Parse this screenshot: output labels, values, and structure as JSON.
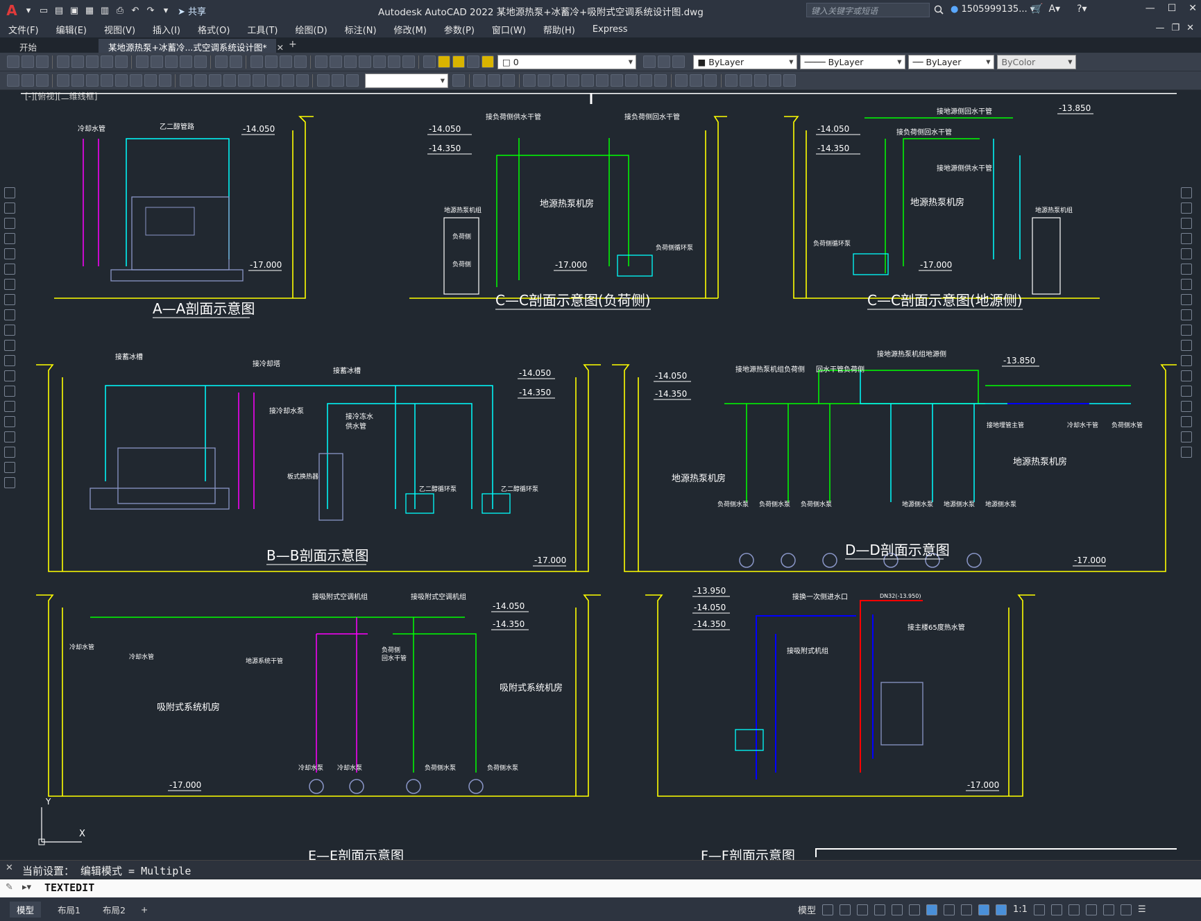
{
  "app": {
    "logo": "A",
    "title": "Autodesk AutoCAD 2022    某地源热泵+冰蓄冷+吸附式空调系统设计图.dwg",
    "share": "共享",
    "search_placeholder": "键入关键字或短语",
    "user": "1505999135...",
    "qa_icons": [
      "new-icon",
      "open-icon",
      "save-icon",
      "save-as-icon",
      "publish-icon",
      "print-icon",
      "undo-icon",
      "redo-icon"
    ]
  },
  "menu": [
    "文件(F)",
    "编辑(E)",
    "视图(V)",
    "插入(I)",
    "格式(O)",
    "工具(T)",
    "绘图(D)",
    "标注(N)",
    "修改(M)",
    "参数(P)",
    "窗口(W)",
    "帮助(H)",
    "Express"
  ],
  "tabs": {
    "start": "开始",
    "drawing": "某地源热泵+冰蓄冷...式空调系统设计图*"
  },
  "toolbar": {
    "layer_value": "0",
    "color": "ByLayer",
    "linetype": "ByLayer",
    "lineweight": "ByLayer",
    "plotstyle": "ByColor"
  },
  "viewport_label": "[-][俯视][二维线框]",
  "drawing": {
    "panels": [
      {
        "id": "aa",
        "title": "A—A剖面示意图",
        "room": "",
        "elevations": [
          "-14.050",
          "-17.000"
        ]
      },
      {
        "id": "cc1",
        "title": "C—C剖面示意图(负荷侧)",
        "room": "地源热泵机房",
        "elevations": [
          "-14.050",
          "-14.350",
          "-17.000"
        ]
      },
      {
        "id": "cc2",
        "title": "C—C剖面示意图(地源侧)",
        "room": "地源热泵机房",
        "elevations": [
          "-14.050",
          "-14.350",
          "-13.850",
          "-17.000"
        ]
      },
      {
        "id": "bb",
        "title": "B—B剖面示意图",
        "room": "",
        "elevations": [
          "-14.050",
          "-14.350",
          "-17.000"
        ]
      },
      {
        "id": "dd",
        "title": "D—D剖面示意图",
        "room": "地源热泵机房",
        "elevations": [
          "-14.050",
          "-14.350",
          "-13.850",
          "-17.000"
        ]
      },
      {
        "id": "ee",
        "title": "E—E剖面示意图",
        "room": "吸附式系统机房",
        "elevations": [
          "-14.050",
          "-14.350",
          "-17.000"
        ]
      },
      {
        "id": "ff",
        "title": "F—F剖面示意图",
        "room": "",
        "elevations": [
          "-13.950",
          "-14.050",
          "-14.350",
          "-17.000"
        ]
      }
    ],
    "labels": {
      "aa_cooling": "冷却水管",
      "aa_glycol": "乙二醇管路",
      "cc1_supply": "接负荷侧供水干管",
      "cc1_return": "接负荷侧回水干管",
      "cc1_unit": "地源热泵机组",
      "cc1_pump": "负荷侧循环泵",
      "cc1_load1": "负荷侧",
      "cc1_load2": "负荷侧",
      "cc2_return": "接地源侧回水干管",
      "cc2_return2": "接负荷侧回水干管",
      "cc2_supply": "接地源侧供水干管",
      "cc2_unit": "地源热泵机组",
      "cc2_pump": "负荷侧循环泵",
      "bb_ice": "接蓄冰槽",
      "bb_cooling": "接冷却塔",
      "bb_ice2": "接蓄冰槽",
      "bb_cwpump": "接冷却水泵",
      "bb_supply": "接冷冻水",
      "bb_supply2": "供水管",
      "bb_hx": "板式换热器",
      "bb_gp1": "乙二醇循环泵",
      "bb_gp2": "乙二醇循环泵",
      "dd_t1": "接地源热泵机组负荷侧",
      "dd_t2": "接地源热泵机组地源侧",
      "dd_t3": "回水干管负荷侧",
      "dd_room2": "地源热泵机房",
      "dd_p1": "负荷侧水泵",
      "dd_p2": "负荷侧水泵",
      "dd_p3": "负荷侧水泵",
      "dd_p4": "地源侧水泵",
      "dd_p5": "地源侧水泵",
      "dd_p6": "地源侧水泵",
      "dd_r1": "接地埋管主管",
      "dd_r2": "冷却水干管",
      "dd_r3": "负荷侧水管",
      "ee_t1": "接吸附式空调机组",
      "ee_t2": "接吸附式空调机组",
      "ee_c1": "冷却水管",
      "ee_c2": "冷却水管",
      "ee_c3": "地源系统干管",
      "ee_c4": "负荷侧",
      "ee_c5": "回水干管",
      "ee_room2": "吸附式系统机房",
      "ee_p1": "冷却水泵",
      "ee_p2": "冷却水泵",
      "ee_p3": "负荷侧水泵",
      "ee_p4": "负荷侧水泵",
      "ff_t1": "接换一次侧进水口",
      "ff_t2": "接吸附式机组",
      "ff_t3": "接主楼65度热水管",
      "ff_dn": "DN32(-13.950)"
    }
  },
  "command": {
    "history": "当前设置： 编辑模式 = Multiple",
    "current": "TEXTEDIT"
  },
  "status": {
    "layouts": [
      "模型",
      "布局1",
      "布局2"
    ],
    "model_label": "模型",
    "scale": "1:1"
  },
  "colors": {
    "wall": "#ffff00",
    "pipe_cyan": "#00ffff",
    "pipe_green": "#00ff00",
    "pipe_magenta": "#ff00ff",
    "pipe_blue": "#0000ff",
    "pipe_red": "#ff0000",
    "equipment": "#8a96c8",
    "text": "#ffffff"
  }
}
